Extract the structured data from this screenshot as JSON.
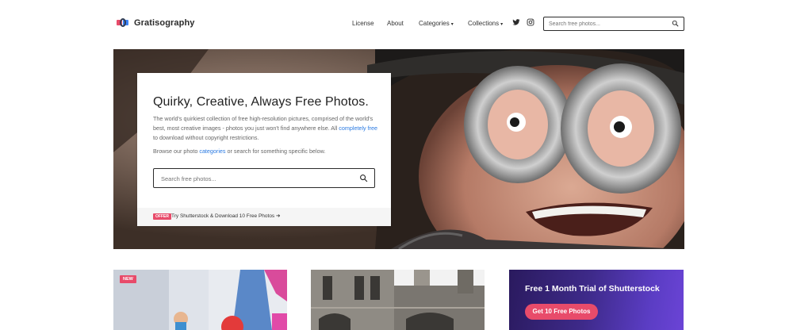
{
  "header": {
    "logo_text": "Gratisography",
    "nav": {
      "license": "License",
      "about": "About",
      "categories": "Categories",
      "collections": "Collections"
    },
    "social": [
      "twitter-icon",
      "instagram-icon"
    ],
    "search_placeholder": "Search free photos..."
  },
  "hero": {
    "title": "Quirky, Creative, Always Free Photos.",
    "description_part1": "The world's quirkiest collection of free high-resolution pictures, comprised of the world's best, most creative images - photos you just won't find anywhere else. All ",
    "description_link": "completely free",
    "description_part2": " to download without copyright restrictions.",
    "browse_part1": "Browse our photo ",
    "browse_link": "categories",
    "browse_part2": " or search for something specific below.",
    "search_placeholder": "Search free photos...",
    "offer_badge": "OFFER",
    "offer_text": "Try Shutterstock & Download 10 Free Photos",
    "offer_arrow": "➔"
  },
  "tiles": {
    "new_badge": "NEW",
    "promo_title": "Free 1 Month Trial of Shutterstock",
    "promo_button": "Get 10 Free Photos"
  },
  "colors": {
    "accent": "#e84b6a",
    "link": "#2a7ae2",
    "promo_bg": "#3e2a8a"
  }
}
